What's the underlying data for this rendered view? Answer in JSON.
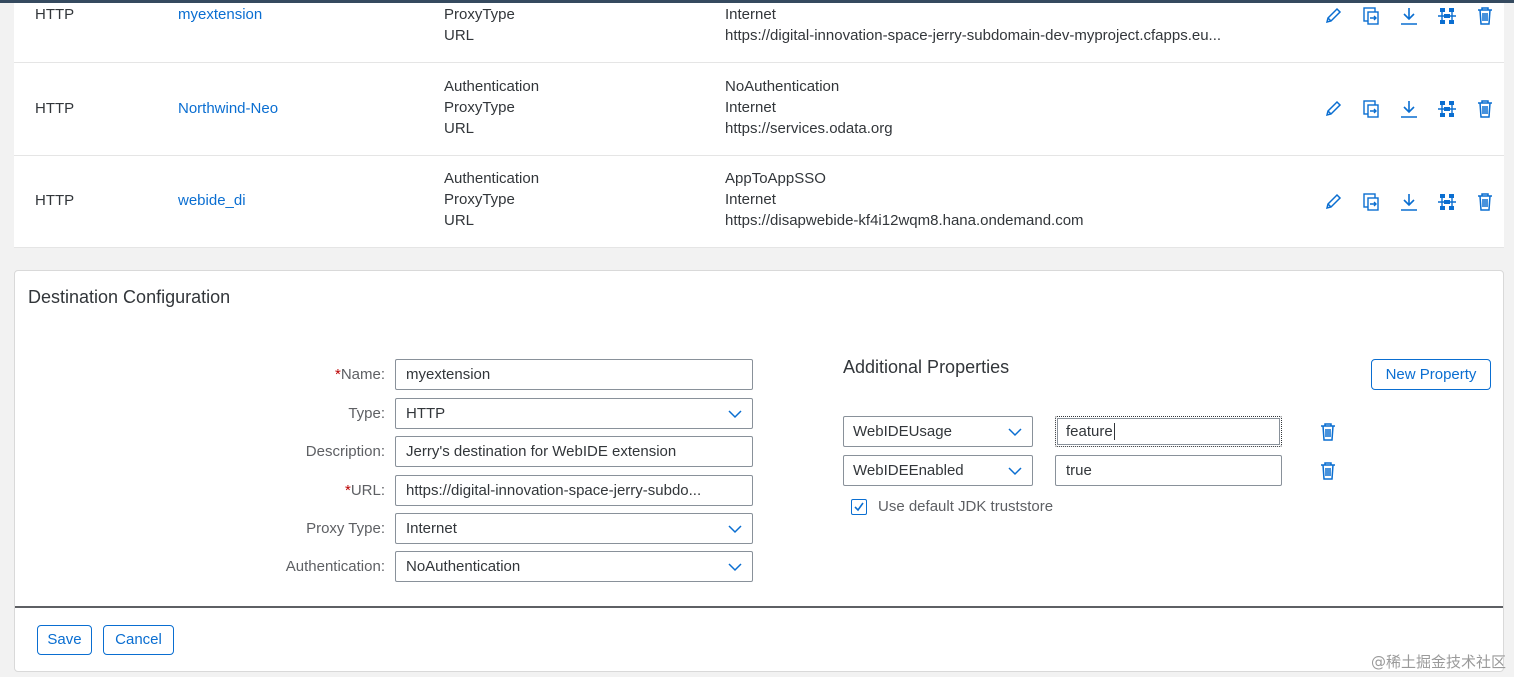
{
  "destinations": [
    {
      "type": "HTTP",
      "name": "myextension",
      "properties": [
        "ProxyType",
        "URL"
      ],
      "values": [
        "Internet",
        "https://digital-innovation-space-jerry-subdomain-dev-myproject.cfapps.eu..."
      ]
    },
    {
      "type": "HTTP",
      "name": "Northwind-Neo",
      "properties": [
        "Authentication",
        "ProxyType",
        "URL"
      ],
      "values": [
        "NoAuthentication",
        "Internet",
        "https://services.odata.org"
      ]
    },
    {
      "type": "HTTP",
      "name": "webide_di",
      "properties": [
        "Authentication",
        "ProxyType",
        "URL"
      ],
      "values": [
        "AppToAppSSO",
        "Internet",
        "https://disapwebide-kf4i12wqm8.hana.ondemand.com"
      ]
    }
  ],
  "row_actions": [
    "edit-icon",
    "clone-icon",
    "download-icon",
    "check-connection-icon",
    "delete-icon"
  ],
  "config": {
    "title": "Destination Configuration",
    "required_marker": "*",
    "fields": {
      "name": {
        "label": "Name:",
        "value": "myextension"
      },
      "type": {
        "label": "Type:",
        "value": "HTTP"
      },
      "description": {
        "label": "Description:",
        "value": "Jerry's destination for WebIDE extension"
      },
      "url": {
        "label": "URL:",
        "value": "https://digital-innovation-space-jerry-subdo..."
      },
      "proxy": {
        "label": "Proxy Type:",
        "value": "Internet"
      },
      "auth": {
        "label": "Authentication:",
        "value": "NoAuthentication"
      }
    },
    "additional": {
      "title": "Additional Properties",
      "new_button": "New Property",
      "props": [
        {
          "key": "WebIDEUsage",
          "value": "feature"
        },
        {
          "key": "WebIDEEnabled",
          "value": "true"
        }
      ],
      "truststore_label": "Use default JDK truststore",
      "truststore_checked": true
    },
    "save_label": "Save",
    "cancel_label": "Cancel"
  },
  "watermark": "@稀土掘金技术社区",
  "colors": {
    "link": "#0a6ed1",
    "text": "#32363a",
    "required": "#bb0000",
    "shell": "#354a5f"
  }
}
